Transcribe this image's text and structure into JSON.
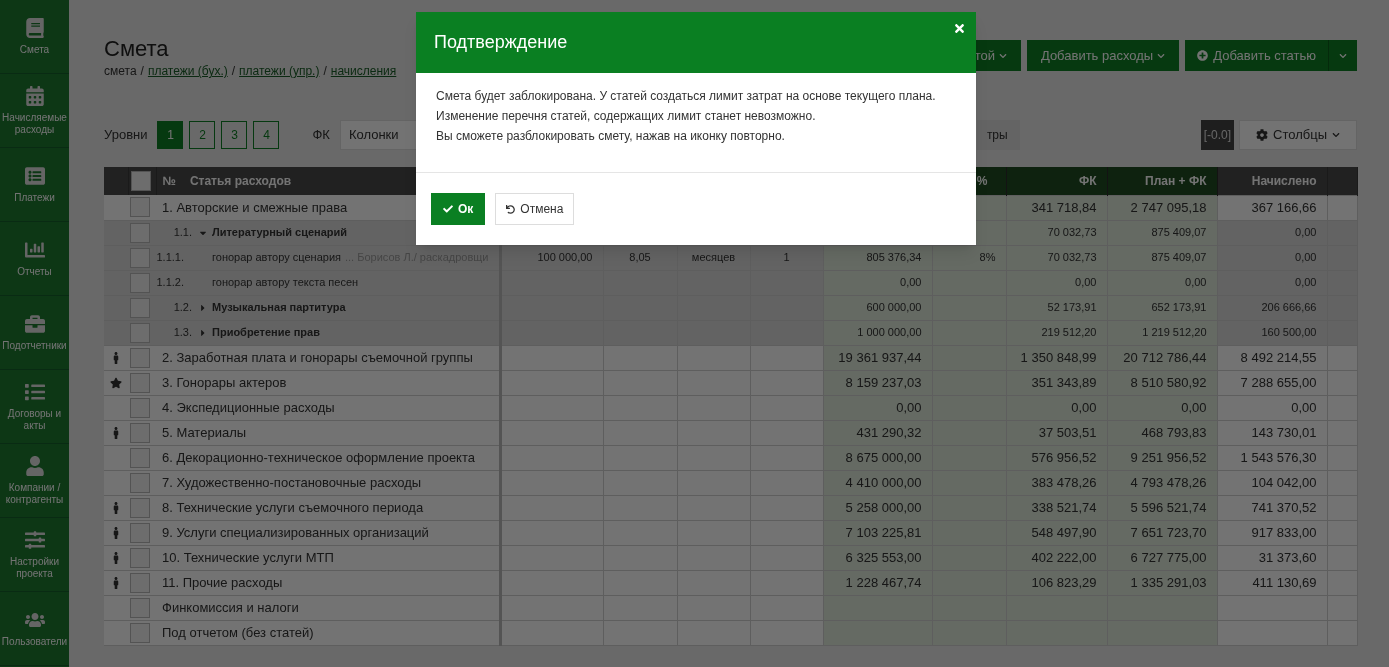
{
  "sidebar": {
    "items": [
      {
        "label": "Смета"
      },
      {
        "label": "Начисляемые расходы"
      },
      {
        "label": "Платежи"
      },
      {
        "label": "Отчеты"
      },
      {
        "label": "Подотчетники"
      },
      {
        "label": "Договоры и акты"
      },
      {
        "label": "Компании / контрагенты"
      },
      {
        "label": "Настройки проекта"
      },
      {
        "label": "Пользователи"
      }
    ]
  },
  "page": {
    "title": "Смета",
    "breadcrumb_separator": "/",
    "breadcrumb": [
      {
        "label": "смета",
        "link": false
      },
      {
        "label": "платежи (бух.)",
        "link": true
      },
      {
        "label": "платежи (упр.)",
        "link": true
      },
      {
        "label": "начисления",
        "link": true
      }
    ]
  },
  "actions": [
    {
      "label": "той"
    },
    {
      "label": "Добавить расходы"
    }
  ],
  "add_button": {
    "label": "Добавить статью"
  },
  "toolbar": {
    "levels_label": "Уровни",
    "levels": [
      {
        "label": "1",
        "selected": true
      },
      {
        "label": "2",
        "selected": false
      },
      {
        "label": "3",
        "selected": false
      },
      {
        "label": "4",
        "selected": false
      }
    ],
    "fk_label": "ФК",
    "columns_select": "Колонки",
    "filter_button": "тры",
    "rounding": "[-0.0]",
    "columns_button": "Столбцы"
  },
  "table": {
    "select_all": {
      "checked": false
    },
    "headers": {
      "number": "№",
      "name": "Статья расходов",
      "percent": "%",
      "fk": "ФК",
      "plan_fk": "План + ФК",
      "accrued": "Начислено"
    },
    "rows": [
      {
        "kind": "group",
        "checked": false,
        "person": false,
        "starred": false,
        "label": "1. Авторские и смежные права",
        "fk": "341 718,84",
        "plan_fk": "2 747 095,18",
        "accrued": "367 166,66"
      },
      {
        "kind": "sub",
        "checked": false,
        "num": "1.1.",
        "label": "Литературный сценарий",
        "expanded": true,
        "fk": "70 032,73",
        "plan_fk": "875 409,07",
        "accrued": "0,00"
      },
      {
        "kind": "item",
        "checked": false,
        "num": "1.1.1.",
        "label": "гонорар автору сценария",
        "note": "... Борисов Л./ раскадровщи",
        "price": "100 000,00",
        "qty": "8,05",
        "unit": "месяцев",
        "count": "1",
        "plan": "805 376,34",
        "percent": "8%",
        "fk": "70 032,73",
        "plan_fk": "875 409,07",
        "accrued": "0,00"
      },
      {
        "kind": "item",
        "checked": false,
        "num": "1.1.2.",
        "label": "гонорар автору текста песен",
        "plan": "0,00",
        "fk": "0,00",
        "plan_fk": "0,00",
        "accrued": "0,00"
      },
      {
        "kind": "sub",
        "checked": false,
        "num": "1.2.",
        "label": "Музыкальная партитура",
        "expanded": false,
        "plan": "600 000,00",
        "fk": "52 173,91",
        "plan_fk": "652 173,91",
        "accrued": "206 666,66"
      },
      {
        "kind": "sub",
        "checked": false,
        "num": "1.3.",
        "label": "Приобретение прав",
        "expanded": false,
        "plan": "1 000 000,00",
        "fk": "219 512,20",
        "plan_fk": "1 219 512,20",
        "accrued": "160 500,00"
      },
      {
        "kind": "group",
        "checked": false,
        "person": true,
        "starred": false,
        "label": "2. Заработная плата и гонорары съемочной группы",
        "plan": "19 361 937,44",
        "fk": "1 350 848,99",
        "plan_fk": "20 712 786,44",
        "accrued": "8 492 214,55"
      },
      {
        "kind": "group",
        "checked": false,
        "person": false,
        "starred": true,
        "label": "3. Гонорары актеров",
        "plan": "8 159 237,03",
        "fk": "351 343,89",
        "plan_fk": "8 510 580,92",
        "accrued": "7 288 655,00"
      },
      {
        "kind": "group",
        "checked": false,
        "person": false,
        "starred": false,
        "label": "4. Экспедиционные расходы",
        "plan": "0,00",
        "fk": "0,00",
        "plan_fk": "0,00",
        "accrued": "0,00"
      },
      {
        "kind": "group",
        "checked": false,
        "person": true,
        "starred": false,
        "label": "5. Материалы",
        "plan": "431 290,32",
        "fk": "37 503,51",
        "plan_fk": "468 793,83",
        "accrued": "143 730,01"
      },
      {
        "kind": "group",
        "checked": false,
        "person": false,
        "starred": false,
        "label": "6. Декорационно-техническое оформление проекта",
        "plan": "8 675 000,00",
        "fk": "576 956,52",
        "plan_fk": "9 251 956,52",
        "accrued": "1 543 576,30"
      },
      {
        "kind": "group",
        "checked": false,
        "person": false,
        "starred": false,
        "label": "7. Художественно-постановочные расходы",
        "plan": "4 410 000,00",
        "fk": "383 478,26",
        "plan_fk": "4 793 478,26",
        "accrued": "104 042,00"
      },
      {
        "kind": "group",
        "checked": false,
        "person": true,
        "starred": false,
        "label": "8. Технические услуги съемочного периода",
        "plan": "5 258 000,00",
        "fk": "338 521,74",
        "plan_fk": "5 596 521,74",
        "accrued": "741 370,52"
      },
      {
        "kind": "group",
        "checked": false,
        "person": true,
        "starred": false,
        "label": "9. Услуги специализированных организаций",
        "plan": "7 103 225,81",
        "fk": "548 497,90",
        "plan_fk": "7 651 723,70",
        "accrued": "917 833,00"
      },
      {
        "kind": "group",
        "checked": false,
        "person": true,
        "starred": false,
        "label": "10. Технические услуги МТП",
        "plan": "6 325 553,00",
        "fk": "402 222,00",
        "plan_fk": "6 727 775,00",
        "accrued": "31 373,60"
      },
      {
        "kind": "group",
        "checked": false,
        "person": true,
        "starred": false,
        "label": "11. Прочие расходы",
        "plan": "1 228 467,74",
        "fk": "106 823,29",
        "plan_fk": "1 335 291,03",
        "accrued": "411 130,69"
      },
      {
        "kind": "group",
        "checked": false,
        "person": false,
        "starred": false,
        "label": "Финкомиссия и налоги"
      },
      {
        "kind": "group",
        "checked": false,
        "person": false,
        "starred": false,
        "label": "Под отчетом (без статей)"
      }
    ]
  },
  "modal": {
    "title": "Подтверждение",
    "lines": [
      "Смета будет заблокирована. У статей создаться лимит затрат на основе текущего плана.",
      "Изменение перечня статей, содержащих лимит станет невозможно.",
      "Вы сможете разблокировать смету, нажав на иконку повторно."
    ],
    "ok": "Ок",
    "cancel": "Отмена"
  }
}
